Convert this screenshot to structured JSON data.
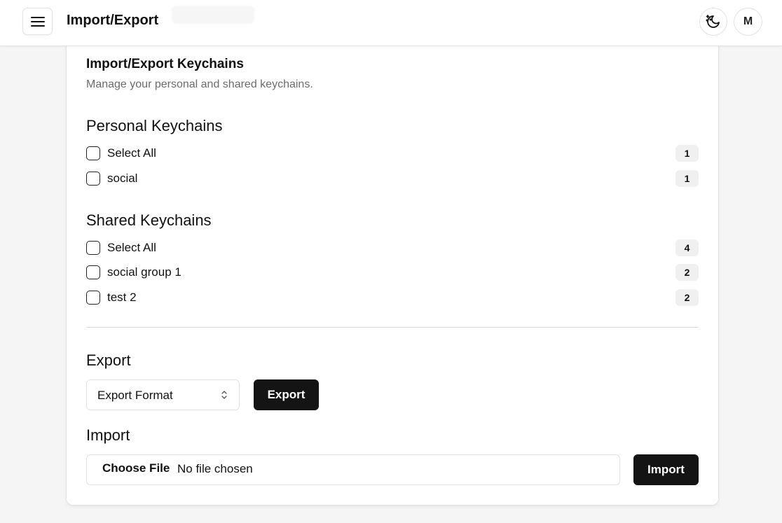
{
  "header": {
    "title": "Import/Export",
    "menu_icon": "hamburger-menu-icon",
    "theme_icon": "moon-stars-icon",
    "avatar_initial": "M"
  },
  "card": {
    "title": "Import/Export Keychains",
    "description": "Manage your personal and shared keychains."
  },
  "personal": {
    "title": "Personal Keychains",
    "rows": [
      {
        "label": "Select All",
        "count": "1"
      },
      {
        "label": "social",
        "count": "1"
      }
    ]
  },
  "shared": {
    "title": "Shared Keychains",
    "rows": [
      {
        "label": "Select All",
        "count": "4"
      },
      {
        "label": "social group 1",
        "count": "2"
      },
      {
        "label": "test 2",
        "count": "2"
      }
    ]
  },
  "export": {
    "title": "Export",
    "format_value": "Export Format",
    "button_label": "Export"
  },
  "import": {
    "title": "Import",
    "choose_label": "Choose File",
    "file_status": "No file chosen",
    "button_label": "Import"
  },
  "colors": {
    "primary_button": "#141414",
    "muted_text": "#6b6b6b",
    "background": "#f5f5f5"
  }
}
